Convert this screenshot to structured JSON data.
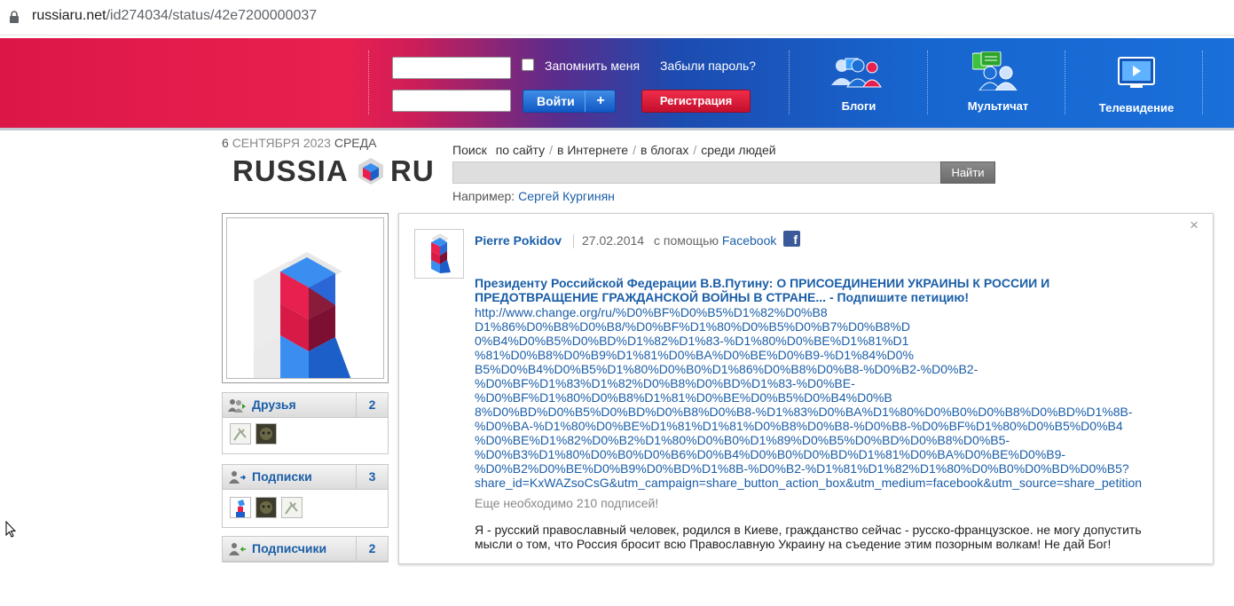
{
  "browser": {
    "url_host": "russiaru.net",
    "url_path": "/id274034/status/42e7200000037"
  },
  "header": {
    "remember_label": "Запомнить меня",
    "forgot_label": "Забыли пароль?",
    "login_label": "Войти",
    "plus_label": "+",
    "register_label": "Регистрация",
    "services": [
      {
        "label": "Блоги",
        "icon": "blogs-icon"
      },
      {
        "label": "Мультичат",
        "icon": "multichat-icon"
      },
      {
        "label": "Телевидение",
        "icon": "tv-icon"
      }
    ],
    "colors": {
      "red": "#e8204f",
      "blue": "#1766d0"
    }
  },
  "date": {
    "day": "6",
    "month": "СЕНТЯБРЯ 2023",
    "weekday": "СРЕДА"
  },
  "logo": {
    "left": "RUSSIA",
    "right": "RU"
  },
  "search": {
    "label": "Поиск",
    "tabs": [
      "по сайту",
      "в Интернете",
      "в блогах",
      "среди людей"
    ],
    "button": "Найти",
    "example_label": "Например:",
    "example_link": "Сергей Кургинян"
  },
  "sidebar": {
    "friends": {
      "title": "Друзья",
      "count": "2"
    },
    "subscriptions": {
      "title": "Подписки",
      "count": "3"
    },
    "subscribers": {
      "title": "Подписчики",
      "count": "2"
    }
  },
  "post": {
    "author": "Pierre Pokidov",
    "date": "27.02.2014",
    "via_label": "с помощью",
    "via_service": "Facebook",
    "close": "×",
    "title_lines": [
      "Президенту Российской Федерации В.В.Путину: О ПРИСОЕДИНЕНИИ УКРАИНЫ К РОССИИ И",
      "ПРЕДОТВРАЩЕНИЕ ГРАЖДАНСКОЙ ВОЙНЫ В СТРАНЕ... - Подпишите петицию!"
    ],
    "link_lines": [
      "http://www.change.org/ru/%D0%BF%D0%B5%D1%82%D0%B8",
      "D1%86%D0%B8%D0%B8/%D0%BF%D1%80%D0%B5%D0%B7%D0%B8%D",
      "0%B4%D0%B5%D0%BD%D1%82%D1%83-%D1%80%D0%BE%D1%81%D1",
      "%81%D0%B8%D0%B9%D1%81%D0%BA%D0%BE%D0%B9-%D1%84%D0%",
      "B5%D0%B4%D0%B5%D1%80%D0%B0%D1%86%D0%B8%D0%B8-%D0%B2-%D0%B2-",
      "%D0%BF%D1%83%D1%82%D0%B8%D0%BD%D1%83-%D0%BE-",
      "%D0%BF%D1%80%D0%B8%D1%81%D0%BE%D0%B5%D0%B4%D0%B",
      "8%D0%BD%D0%B5%D0%BD%D0%B8%D0%B8-%D1%83%D0%BA%D1%80%D0%B0%D0%B8%D0%BD%D1%8B-",
      "%D0%BA-%D1%80%D0%BE%D1%81%D1%81%D0%B8%D0%B8-%D0%B8-%D0%BF%D1%80%D0%B5%D0%B4",
      "%D0%BE%D1%82%D0%B2%D1%80%D0%B0%D1%89%D0%B5%D0%BD%D0%B8%D0%B5-",
      "%D0%B3%D1%80%D0%B0%D0%B6%D0%B4%D0%B0%D0%BD%D1%81%D0%BA%D0%BE%D0%B9-",
      "%D0%B2%D0%BE%D0%B9%D0%BD%D1%8B-%D0%B2-%D1%81%D1%82%D1%80%D0%B0%D0%BD%D0%B5?",
      "share_id=KxWAZsoCsG&utm_campaign=share_button_action_box&utm_medium=facebook&utm_source=share_petition"
    ],
    "remaining": "Еще необходимо 210 подписей!",
    "text_lines": [
      "Я - русский православный человек, родился в Киеве, гражданство сейчас - русско-французское. не могу допустить",
      "мысли о том, что Россия бросит всю Православную Украину на съедение этим позорным волкам! Не дай Бог!"
    ]
  }
}
